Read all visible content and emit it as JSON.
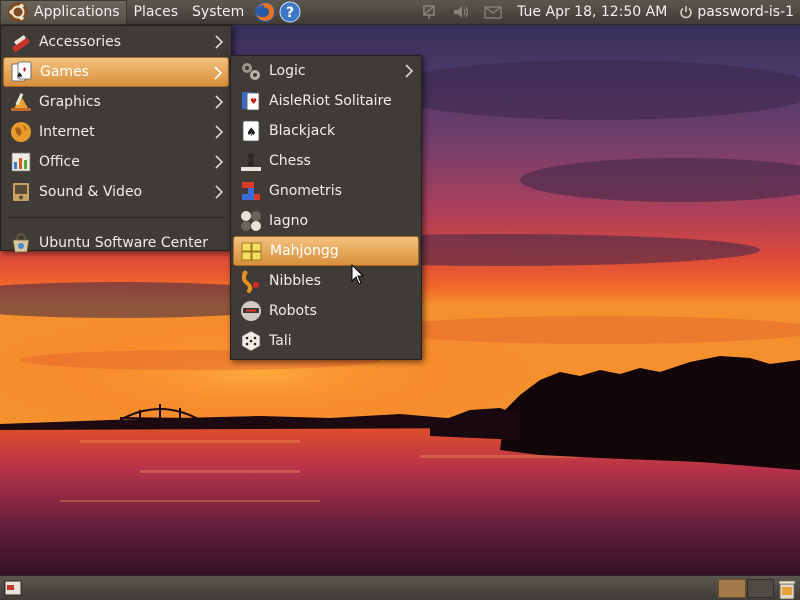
{
  "top_panel": {
    "menus": {
      "applications": "Applications",
      "places": "Places",
      "system": "System"
    },
    "launchers": [
      "firefox-icon",
      "help-icon"
    ],
    "tray": [
      "network-icon",
      "volume-icon",
      "mail-icon"
    ],
    "clock": "Tue Apr 18, 12:50 AM",
    "user": "password-is-1"
  },
  "applications_menu": {
    "items": [
      {
        "label": "Accessories",
        "icon": "accessories-icon",
        "submenu": true
      },
      {
        "label": "Games",
        "icon": "games-icon",
        "submenu": true,
        "selected": true
      },
      {
        "label": "Graphics",
        "icon": "graphics-icon",
        "submenu": true
      },
      {
        "label": "Internet",
        "icon": "internet-icon",
        "submenu": true
      },
      {
        "label": "Office",
        "icon": "office-icon",
        "submenu": true
      },
      {
        "label": "Sound & Video",
        "icon": "sound-video-icon",
        "submenu": true
      }
    ],
    "footer_item": {
      "label": "Ubuntu Software Center",
      "icon": "software-center-icon"
    }
  },
  "games_menu": {
    "items": [
      {
        "label": "Logic",
        "icon": "logic-icon",
        "submenu": true
      },
      {
        "label": "AisleRiot Solitaire",
        "icon": "solitaire-icon"
      },
      {
        "label": "Blackjack",
        "icon": "blackjack-icon"
      },
      {
        "label": "Chess",
        "icon": "chess-icon"
      },
      {
        "label": "Gnometris",
        "icon": "gnometris-icon"
      },
      {
        "label": "Iagno",
        "icon": "iagno-icon"
      },
      {
        "label": "Mahjongg",
        "icon": "mahjongg-icon",
        "selected": true
      },
      {
        "label": "Nibbles",
        "icon": "nibbles-icon"
      },
      {
        "label": "Robots",
        "icon": "robots-icon"
      },
      {
        "label": "Tali",
        "icon": "tali-icon"
      }
    ]
  },
  "colors": {
    "panel": "#3f3c37",
    "menu_bg": "#3f3c37",
    "highlight": "#e3a258",
    "text": "#f0eeea"
  }
}
